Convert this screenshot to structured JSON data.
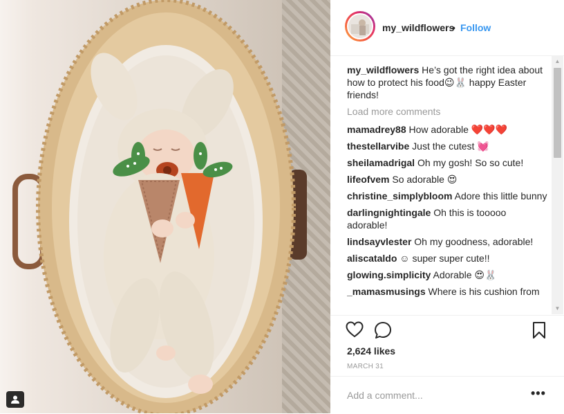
{
  "post": {
    "username": "my_wildflowers",
    "separator": "•",
    "follow_label": "Follow",
    "caption_user": "my_wildflowers",
    "caption_text": "He’s got the right idea about how to protect his food😉🐰 happy Easter friends!",
    "load_more_label": "Load more comments",
    "comments": [
      {
        "user": "mamadrey88",
        "text": "How adorable ❤️❤️❤️"
      },
      {
        "user": "thestellarvibe",
        "text": "Just the cutest 💓"
      },
      {
        "user": "sheilamadrigal",
        "text": "Oh my gosh! So so cute!"
      },
      {
        "user": "lifeofvem",
        "text": "So adorable 😍"
      },
      {
        "user": "christine_simplybloom",
        "text": "Adore this little bunny"
      },
      {
        "user": "darlingnightingale",
        "text": "Oh this is tooooo adorable!"
      },
      {
        "user": "lindsayvlester",
        "text": "Oh my goodness, adorable!"
      },
      {
        "user": "aliscataldo",
        "text": "☺ super super cute!!"
      },
      {
        "user": "glowing.simplicity",
        "text": "Adorable 😍🐰"
      },
      {
        "user": "_mamasmusings",
        "text": "Where is his cushion from"
      }
    ],
    "likes_text": "2,624 likes",
    "date_text": "MARCH 31",
    "add_comment_placeholder": "Add a comment...",
    "more_options_label": "•••",
    "icons": {
      "like": "heart-icon",
      "comment": "comment-bubble-icon",
      "save": "bookmark-icon",
      "tagged_users": "user-tag-icon"
    },
    "colors": {
      "link_blue": "#3897f0",
      "muted_gray": "#999999",
      "text": "#262626"
    }
  }
}
